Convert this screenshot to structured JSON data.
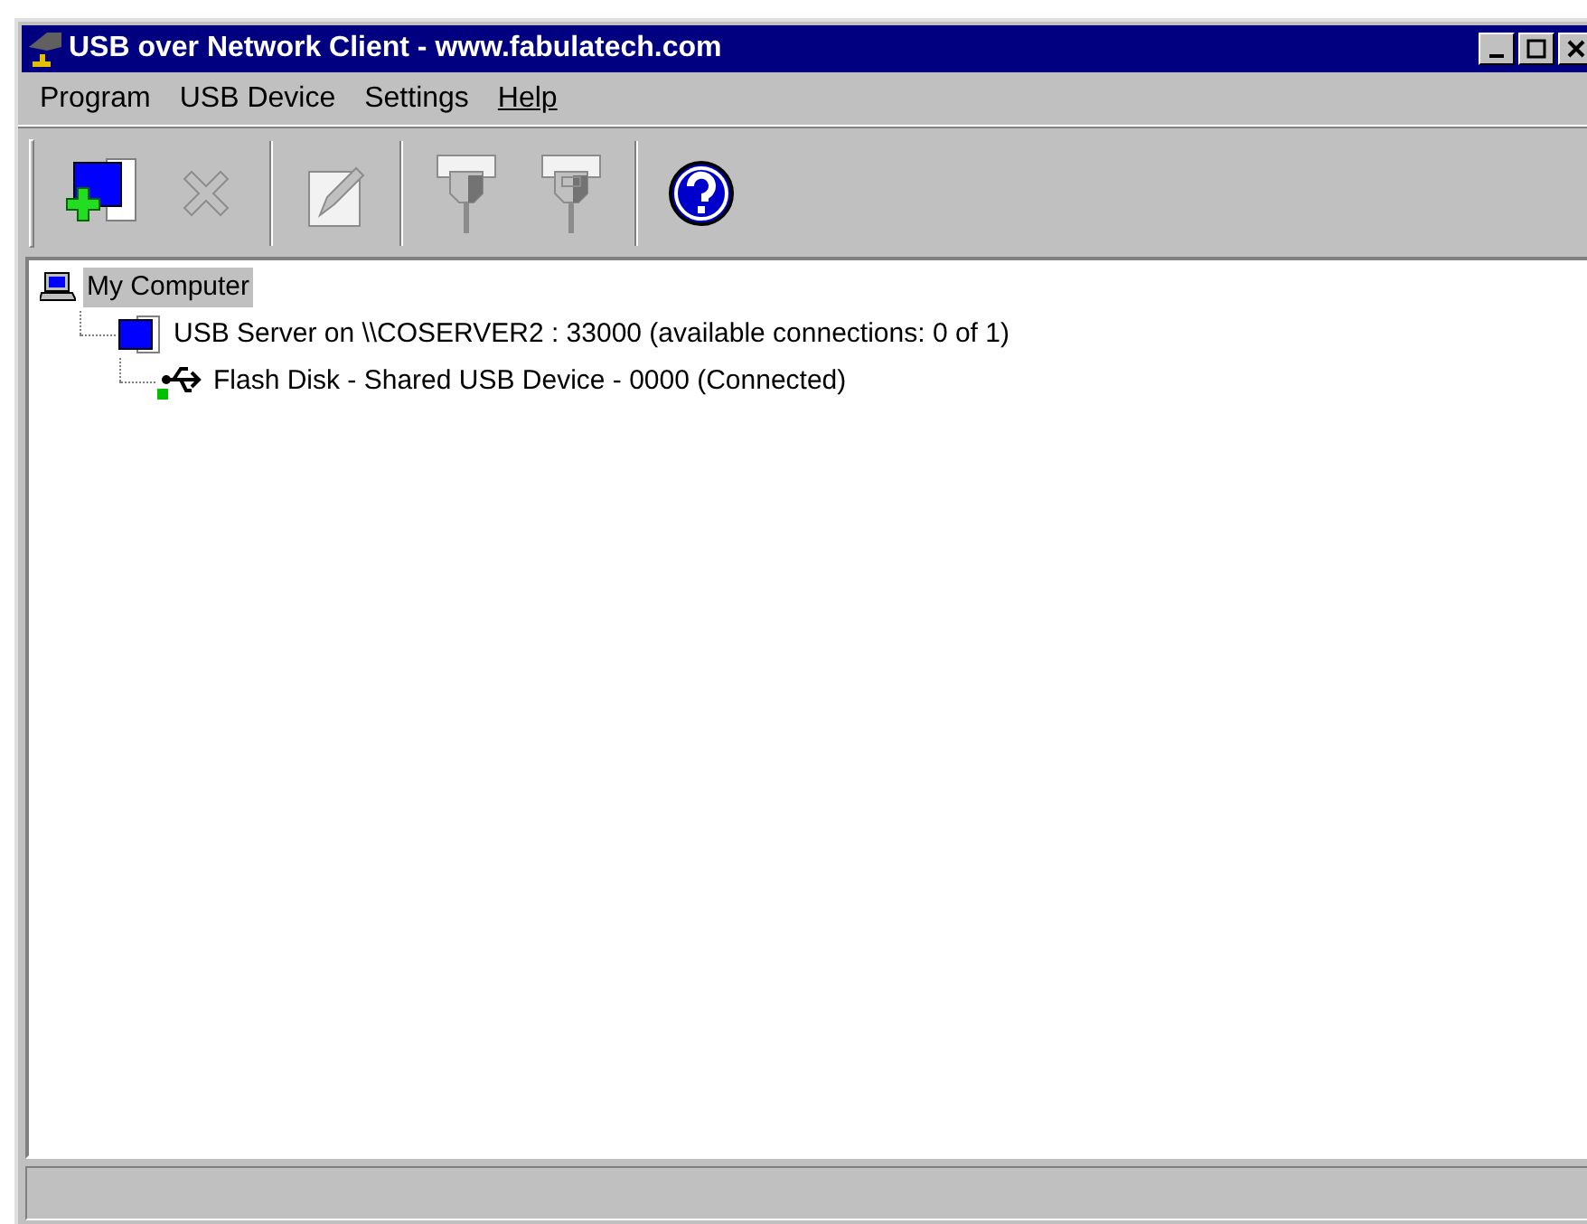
{
  "window": {
    "title": "USB over Network Client - www.fabulatech.com"
  },
  "menu": [
    {
      "label": "Program",
      "underline_first": false
    },
    {
      "label": "USB Device",
      "underline_first": false
    },
    {
      "label": "Settings",
      "underline_first": false
    },
    {
      "label": "Help",
      "underline_first": true
    }
  ],
  "toolbar": [
    {
      "kind": "add",
      "disabled": false
    },
    {
      "kind": "delete",
      "disabled": true
    },
    {
      "kind": "separator"
    },
    {
      "kind": "edit",
      "disabled": true
    },
    {
      "kind": "separator"
    },
    {
      "kind": "connect",
      "disabled": true
    },
    {
      "kind": "disconnect",
      "disabled": true
    },
    {
      "kind": "separator"
    },
    {
      "kind": "help",
      "disabled": false
    }
  ],
  "tree": [
    {
      "kind": "computer",
      "label": "My Computer",
      "selected": true,
      "children": [
        {
          "kind": "server",
          "label": "USB Server on \\\\COSERVER2 : 33000 (available connections: 0 of 1)",
          "selected": false,
          "children": [
            {
              "kind": "usb",
              "label": "Flash Disk - Shared USB Device - 0000 (Connected)",
              "selected": false,
              "connected": true
            }
          ]
        }
      ]
    }
  ]
}
